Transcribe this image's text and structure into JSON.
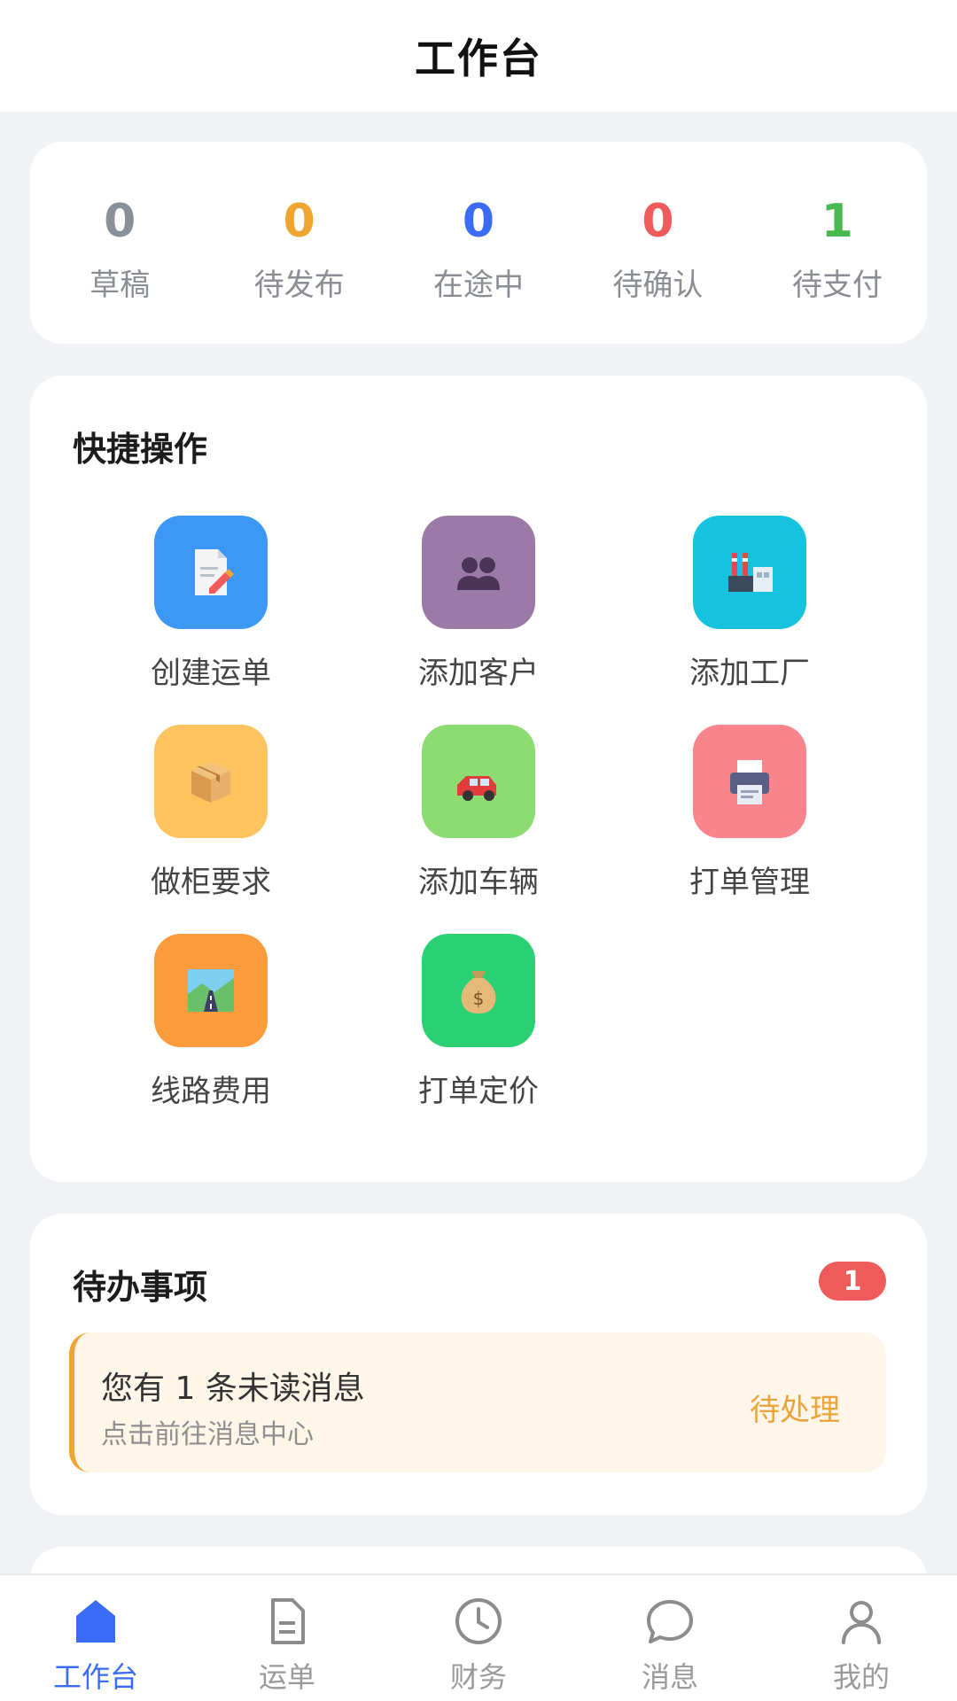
{
  "header": {
    "title": "工作台"
  },
  "stats": [
    {
      "value": "0",
      "label": "草稿",
      "color": "#8a9098"
    },
    {
      "value": "0",
      "label": "待发布",
      "color": "#f0a531"
    },
    {
      "value": "0",
      "label": "在途中",
      "color": "#3b6cf6"
    },
    {
      "value": "0",
      "label": "待确认",
      "color": "#ef5a5a"
    },
    {
      "value": "1",
      "label": "待支付",
      "color": "#47b94e"
    }
  ],
  "quick_actions": {
    "title": "快捷操作",
    "items": [
      {
        "label": "创建运单",
        "icon": "document-edit-icon",
        "bg": "#3d98f5"
      },
      {
        "label": "添加客户",
        "icon": "people-icon",
        "bg": "#9c7aa8"
      },
      {
        "label": "添加工厂",
        "icon": "factory-icon",
        "bg": "#17c2de"
      },
      {
        "label": "做柜要求",
        "icon": "box-icon",
        "bg": "#fcc35e"
      },
      {
        "label": "添加车辆",
        "icon": "car-icon",
        "bg": "#8ddc72"
      },
      {
        "label": "打单管理",
        "icon": "printer-icon",
        "bg": "#f9848c"
      },
      {
        "label": "线路费用",
        "icon": "road-icon",
        "bg": "#fb9b3b"
      },
      {
        "label": "打单定价",
        "icon": "money-bag-icon",
        "bg": "#2bd075"
      }
    ]
  },
  "todo": {
    "title": "待办事项",
    "badge": "1",
    "item": {
      "main": "您有 1 条未读消息",
      "sub": "点击前往消息中心",
      "status": "待处理"
    }
  },
  "tabbar": {
    "items": [
      {
        "label": "工作台",
        "icon": "home-icon",
        "active": true
      },
      {
        "label": "运单",
        "icon": "document-icon",
        "active": false
      },
      {
        "label": "财务",
        "icon": "clock-icon",
        "active": false
      },
      {
        "label": "消息",
        "icon": "chat-bubble-icon",
        "active": false
      },
      {
        "label": "我的",
        "icon": "user-icon",
        "active": false
      }
    ]
  },
  "colors": {
    "accent": "#3b6cf6",
    "page_bg": "#f2f3f7",
    "badge": "#ef5a5a",
    "todo_bg": "#fff6ea",
    "todo_status": "#e9a53c"
  }
}
